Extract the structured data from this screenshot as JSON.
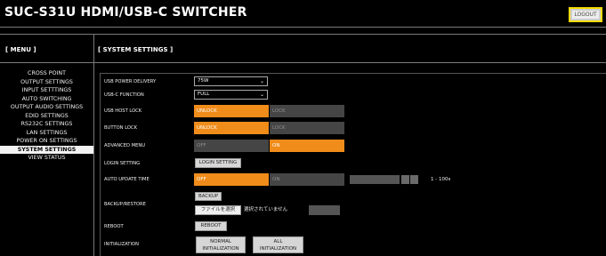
{
  "header": {
    "title": "SUC-S31U HDMI/USB-C SWITCHER",
    "logout_label": "LOGOUT"
  },
  "menu": {
    "title": "[ MENU ]",
    "items": [
      {
        "label": "CROSS POINT"
      },
      {
        "label": "OUTPUT SETTINGS"
      },
      {
        "label": "INPUT SETTTINGS"
      },
      {
        "label": "AUTO SWITCHING"
      },
      {
        "label": "OUTPUT AUDIO SETTINGS"
      },
      {
        "label": "EDID SETTINGS"
      },
      {
        "label": "RS232C SETTINGS"
      },
      {
        "label": "LAN SETTINGS"
      },
      {
        "label": "POWER ON SETTINGS"
      },
      {
        "label": "SYSTEM SETTINGS"
      },
      {
        "label": "VIEW STATUS"
      }
    ],
    "active": "SYSTEM SETTINGS"
  },
  "page": {
    "title": "[ SYSTEM SETTINGS ]"
  },
  "settings": {
    "usb_power_delivery": {
      "label": "USB POWER DELIVERY",
      "value": "75W"
    },
    "usbc_function": {
      "label": "USB-C FUNCTION",
      "value": "FULL"
    },
    "usb_host_lock": {
      "label": "USB HOST LOCK",
      "on": "UNLOCK",
      "off": "LOCK"
    },
    "button_lock": {
      "label": "BUTTON LOCK",
      "on": "UNLOCK",
      "off": "LOCK"
    },
    "advanced_menu": {
      "label": "ADVANCED MENU",
      "off": "OFF",
      "on": "ON"
    },
    "login_setting": {
      "label": "LOGIN SETTING",
      "button": "LOGIN SETTING"
    },
    "auto_update_time": {
      "label": "AUTO UPDATE TIME",
      "on": "OFF",
      "off": "ON",
      "range": "1 - 100s"
    },
    "backup_restore": {
      "label": "BACKUP/RESTORE",
      "backup_button": "BACKUP",
      "choose_file": "ファイルを選択",
      "no_file": "選択されていません"
    },
    "reboot": {
      "label": "REBOOT",
      "button": "REBOOT"
    },
    "initialization": {
      "label": "INITIALIZATION",
      "normal_line1": "NORMAL",
      "normal_line2": "INITIALIZATION",
      "all_line1": "ALL",
      "all_line2": "INITIALIZATION"
    }
  },
  "colors": {
    "accent": "#f08c1a",
    "logout_border": "#f3dc00",
    "background": "#000000"
  }
}
